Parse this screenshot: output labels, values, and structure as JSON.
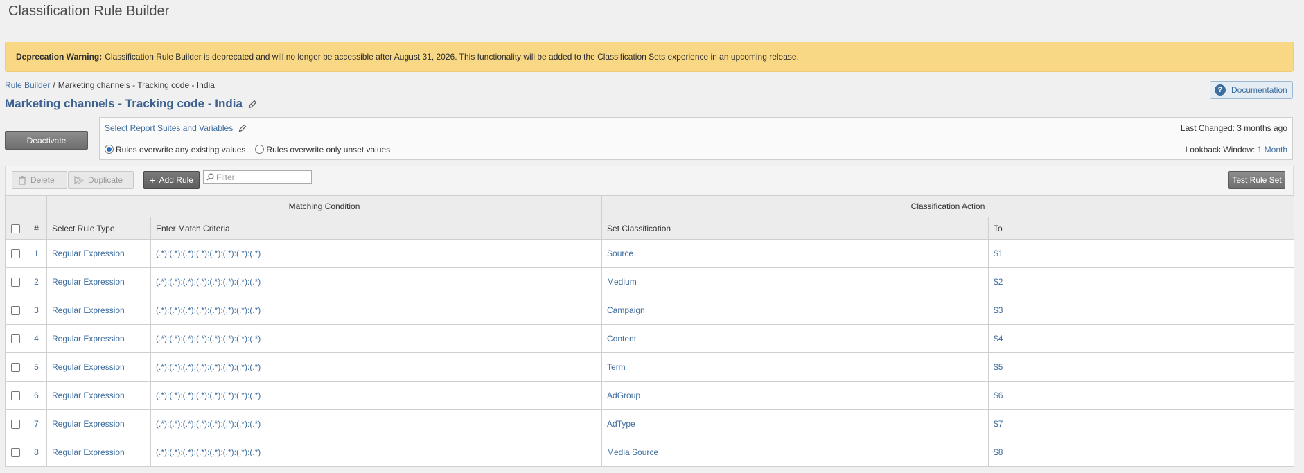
{
  "header": {
    "title": "Classification Rule Builder"
  },
  "warning": {
    "label": "Deprecation Warning:",
    "message": "Classification Rule Builder is deprecated and will no longer be accessible after August 31, 2026. This functionality will be added to the Classification Sets experience in an upcoming release."
  },
  "breadcrumb": {
    "root": "Rule Builder",
    "separator": "/",
    "current": "Marketing channels - Tracking code - India"
  },
  "documentation": {
    "label": "Documentation",
    "icon": "help-icon"
  },
  "rule_set": {
    "title": "Marketing channels - Tracking code - India"
  },
  "actions": {
    "deactivate": "Deactivate"
  },
  "settings": {
    "select_link": "Select Report Suites and Variables",
    "last_changed": "Last Changed: 3 months ago",
    "lookback_label": "Lookback Window:",
    "lookback_value": "1 Month",
    "options": [
      {
        "label": "Rules overwrite any existing values",
        "selected": true
      },
      {
        "label": "Rules overwrite only unset values",
        "selected": false
      }
    ]
  },
  "toolbar": {
    "delete": "Delete",
    "duplicate": "Duplicate",
    "add_rule": "Add Rule",
    "filter_placeholder": "Filter",
    "test_rule_set": "Test Rule Set"
  },
  "table": {
    "groups": {
      "matching": "Matching Condition",
      "classification": "Classification Action"
    },
    "columns": {
      "num": "#",
      "rule_type": "Select Rule Type",
      "match_criteria": "Enter Match Criteria",
      "set_classification": "Set Classification",
      "to": "To"
    },
    "rows": [
      {
        "num": "1",
        "type": "Regular Expression",
        "criteria": "(.*):(.*):(.*):(.*):(.*):(.*):(.*):(.*)",
        "classification": "Source",
        "to": "$1"
      },
      {
        "num": "2",
        "type": "Regular Expression",
        "criteria": "(.*):(.*):(.*):(.*):(.*):(.*):(.*):(.*)",
        "classification": "Medium",
        "to": "$2"
      },
      {
        "num": "3",
        "type": "Regular Expression",
        "criteria": "(.*):(.*):(.*):(.*):(.*):(.*):(.*):(.*)",
        "classification": "Campaign",
        "to": "$3"
      },
      {
        "num": "4",
        "type": "Regular Expression",
        "criteria": "(.*):(.*):(.*):(.*):(.*):(.*):(.*):(.*)",
        "classification": "Content",
        "to": "$4"
      },
      {
        "num": "5",
        "type": "Regular Expression",
        "criteria": "(.*):(.*):(.*):(.*):(.*):(.*):(.*):(.*)",
        "classification": "Term",
        "to": "$5"
      },
      {
        "num": "6",
        "type": "Regular Expression",
        "criteria": "(.*):(.*):(.*):(.*):(.*):(.*):(.*):(.*)",
        "classification": "AdGroup",
        "to": "$6"
      },
      {
        "num": "7",
        "type": "Regular Expression",
        "criteria": "(.*):(.*):(.*):(.*):(.*):(.*):(.*):(.*)",
        "classification": "AdType",
        "to": "$7"
      },
      {
        "num": "8",
        "type": "Regular Expression",
        "criteria": "(.*):(.*):(.*):(.*):(.*):(.*):(.*):(.*)",
        "classification": "Media Source",
        "to": "$8"
      }
    ]
  }
}
